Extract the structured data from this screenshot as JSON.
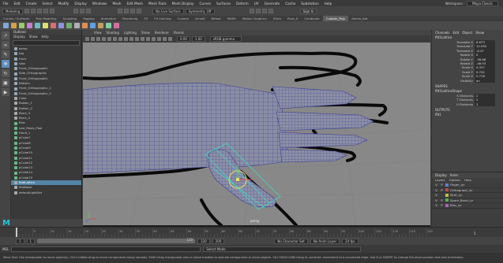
{
  "menubar": {
    "items": [
      "File",
      "Edit",
      "Create",
      "Select",
      "Modify",
      "Display",
      "Windows",
      "Mesh",
      "Edit Mesh",
      "Mesh Tools",
      "Mesh Display",
      "Curves",
      "Surfaces",
      "Deform",
      "UV",
      "Generate",
      "Cache",
      "Substation",
      "Help"
    ],
    "workspace_label": "Workspace :",
    "workspace_value": "Maya Classic"
  },
  "statusline": {
    "mode": "Modeling",
    "live_surface": "No Live Surface",
    "symmetry": "Symmetry: Off",
    "sign_in": "Sign In"
  },
  "shelf_tabs": [
    "Curves / Surfaces",
    "Poly Modeling",
    "Sculpting",
    "Rigging",
    "Animation",
    "Rendering",
    "FX",
    "FX Caching",
    "Custom",
    "Arnold",
    "Bifrost",
    "MASH",
    "Motion Graphics",
    "XGen",
    "Pose_it",
    "Conductor",
    "Custom_Poly",
    "Ahmio_Bot"
  ],
  "shelf_active": "Custom_Poly",
  "outliner": {
    "title": "Outliner",
    "menu": [
      "Display",
      "Show",
      "Help"
    ],
    "rows": [
      {
        "label": "persp",
        "kind": "cam"
      },
      {
        "label": "top",
        "kind": "cam"
      },
      {
        "label": "front",
        "kind": "cam"
      },
      {
        "label": "side",
        "kind": "cam"
      },
      {
        "label": "Front_Orthographic",
        "kind": "cam"
      },
      {
        "label": "Side_Orthographic",
        "kind": "cam"
      },
      {
        "label": "Front_Orthographic",
        "kind": "cam"
      },
      {
        "label": "Bottom",
        "kind": "cam"
      },
      {
        "label": "Front_Orthographic_2",
        "kind": "cam"
      },
      {
        "label": "Front_Orthographic_2",
        "kind": "cam"
      },
      {
        "label": "Color",
        "kind": "dot"
      },
      {
        "label": "Button_1",
        "kind": "dot"
      },
      {
        "label": "Button_2",
        "kind": "dot"
      },
      {
        "label": "Bone_3",
        "kind": "dot"
      },
      {
        "label": "Bone_4",
        "kind": "dot"
      },
      {
        "label": "Bloc",
        "kind": "mesh"
      },
      {
        "label": "Low_Reals_Pool",
        "kind": "mesh"
      },
      {
        "label": "Hand_1",
        "kind": "mesh"
      },
      {
        "label": "pCube7",
        "kind": "mesh"
      },
      {
        "label": "pCube8",
        "kind": "mesh"
      },
      {
        "label": "pCube9",
        "kind": "mesh"
      },
      {
        "label": "pCube10",
        "kind": "mesh"
      },
      {
        "label": "pCube11",
        "kind": "mesh"
      },
      {
        "label": "pCube12",
        "kind": "mesh"
      },
      {
        "label": "pCube13",
        "kind": "mesh"
      },
      {
        "label": "pCube14",
        "kind": "mesh"
      },
      {
        "label": "pCube15",
        "kind": "mesh"
      },
      {
        "label": "fiddLattice",
        "kind": "dot"
      },
      {
        "label": "fiddBase",
        "kind": "dot"
      },
      {
        "label": "defaultLightSet",
        "kind": "dot"
      }
    ],
    "selected_index": 27
  },
  "viewport": {
    "menu": [
      "View",
      "Shading",
      "Lighting",
      "Show",
      "Renderer",
      "Panels"
    ],
    "camera_label": "persp",
    "color_space": "sRGB gamma",
    "val1": "0.00",
    "val2": "1.00"
  },
  "channelbox": {
    "menu": [
      "Channels",
      "Edit",
      "Object",
      "Show"
    ],
    "object": "ffd1Lattice",
    "attrs": [
      {
        "name": "Translate X",
        "value": "6.673"
      },
      {
        "name": "Translate Y",
        "value": "12.092"
      },
      {
        "name": "Translate Z",
        "value": "-6.47"
      },
      {
        "name": "Rotate X",
        "value": "0"
      },
      {
        "name": "Rotate Y",
        "value": "-38.68"
      },
      {
        "name": "Rotate Z",
        "value": "-48.93"
      },
      {
        "name": "Scale X",
        "value": "0.337"
      },
      {
        "name": "Scale Y",
        "value": "0.742"
      },
      {
        "name": "Scale Z",
        "value": "0.718"
      },
      {
        "name": "Visibility",
        "value": "on"
      }
    ],
    "shapes_title": "SHAPES",
    "shape_name": "ffd1LatticeShape",
    "shape_attrs": [
      {
        "name": "S Divisions",
        "value": "2"
      },
      {
        "name": "T Divisions",
        "value": "2"
      },
      {
        "name": "U Divisions",
        "value": "2"
      }
    ],
    "outputs_title": "OUTPUTS",
    "output_name": "ffd1"
  },
  "layers": {
    "tabs": [
      "Display",
      "Anim"
    ],
    "menu": [
      "Layers",
      "Options",
      "Help"
    ],
    "rows": [
      {
        "v": "V",
        "p": "P",
        "name": "Finger_lyr",
        "color": "#5a7fd0"
      },
      {
        "v": "V",
        "p": "P",
        "name": "Orthograph_lyr",
        "color": "#c04848"
      },
      {
        "v": "V",
        "p": "",
        "name": "Skirt_lyr",
        "color": "#c0c040"
      },
      {
        "v": "V",
        "p": "P",
        "name": "Spare_Bone_lyr",
        "color": "#50b050"
      },
      {
        "v": "V",
        "p": "P",
        "name": "Bloc_lyr",
        "color": "#b060c0"
      }
    ]
  },
  "timeslider": {
    "ticks": [
      "5",
      "10",
      "15",
      "20",
      "25",
      "30",
      "35",
      "40",
      "45",
      "50",
      "55",
      "60",
      "65",
      "70",
      "75",
      "80",
      "85",
      "90",
      "95",
      "100",
      "105",
      "110",
      "115",
      "120"
    ],
    "current_frame": "1"
  },
  "range": {
    "start": "1",
    "inner_start": "1",
    "inner_end": "120",
    "end": "120",
    "end2": "200",
    "character_set": "No Character Set",
    "anim_layer": "No Anim Layer",
    "fps": "24 fps"
  },
  "cmdline": {
    "lang": "MEL",
    "feedback": "Select Mode"
  },
  "helpline": {
    "text": "Move Tool: Use manipulator to move object(s). Ctrl+middle-drag to move components along normals. Shift+drag manipulator axis or plane handles to extrude components or clone objects. Ctrl+Shift+LMB+drag to constrain movement to a connected edge. Use D or INSERT to change the pivot position and axis orientation."
  },
  "colors": {
    "selection": "#5285a6",
    "maya_logo": "#22c4d8",
    "mesh_wire": "#3b3b9a",
    "lattice": "#3fd9c8"
  },
  "icons": [
    "select-arrow-icon",
    "lasso-icon",
    "paint-select-icon",
    "move-icon",
    "rotate-icon",
    "scale-icon",
    "maya-logo-icon"
  ]
}
